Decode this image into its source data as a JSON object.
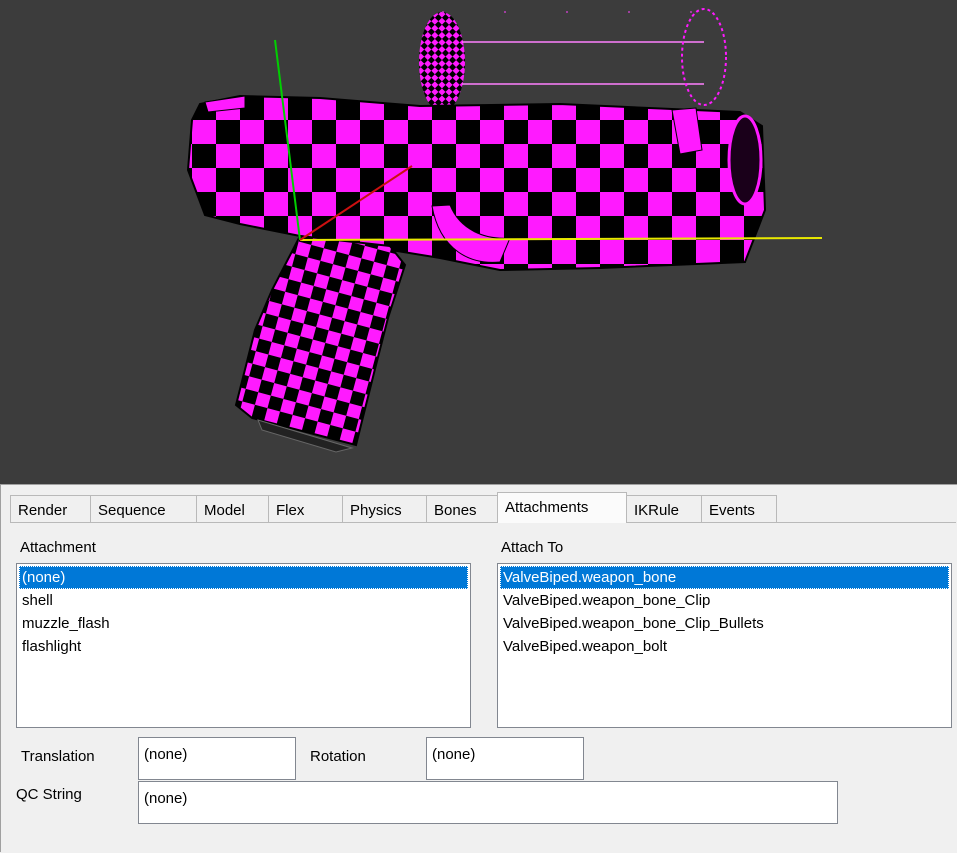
{
  "tabs": [
    {
      "label": "Render",
      "active": false
    },
    {
      "label": "Sequence",
      "active": false
    },
    {
      "label": "Model",
      "active": false
    },
    {
      "label": "Flex",
      "active": false
    },
    {
      "label": "Physics",
      "active": false
    },
    {
      "label": "Bones",
      "active": false
    },
    {
      "label": "Attachments",
      "active": true
    },
    {
      "label": "IKRule",
      "active": false
    },
    {
      "label": "Events",
      "active": false
    }
  ],
  "attachment": {
    "label": "Attachment",
    "items": [
      "(none)",
      "shell",
      "muzzle_flash",
      "flashlight"
    ],
    "selected": "(none)"
  },
  "attach_to": {
    "label": "Attach To",
    "items": [
      "ValveBiped.weapon_bone",
      "ValveBiped.weapon_bone_Clip",
      "ValveBiped.weapon_bone_Clip_Bullets",
      "ValveBiped.weapon_bolt"
    ],
    "selected": "ValveBiped.weapon_bone"
  },
  "translation": {
    "label": "Translation",
    "value": "(none)"
  },
  "rotation": {
    "label": "Rotation",
    "value": "(none)"
  },
  "qc_string": {
    "label": "QC String",
    "value": "(none)"
  },
  "viewport": {
    "background": "#3c3c3c",
    "model_color": "#ff1aff",
    "axis_colors": {
      "x": "#e8e800",
      "y": "#00d000",
      "z": "#cc1010"
    }
  }
}
